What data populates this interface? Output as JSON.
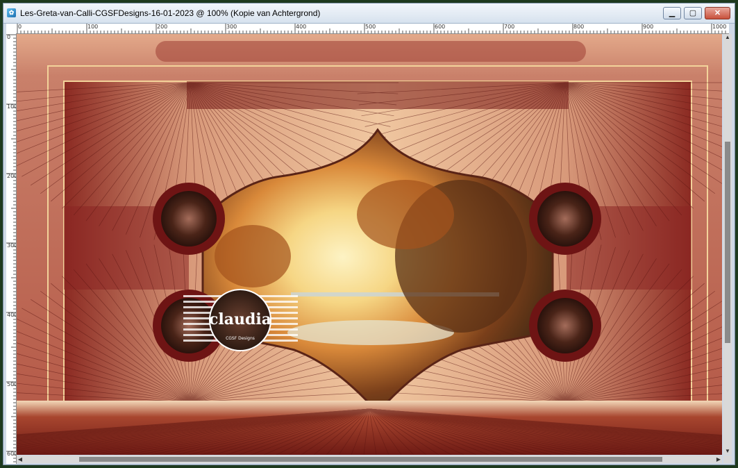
{
  "window": {
    "title": "Les-Greta-van-Calli-CGSFDesigns-16-01-2023 @ 100% (Kopie van Achtergrond)",
    "app_icon_glyph": "✿",
    "minimize_glyph": "▁",
    "maximize_glyph": "▢",
    "close_glyph": "✕"
  },
  "ruler": {
    "h_labels": [
      "0",
      "100",
      "200",
      "300",
      "400",
      "500",
      "600",
      "700",
      "800",
      "900",
      "1000"
    ],
    "v_labels": [
      "0",
      "100",
      "200",
      "300",
      "400",
      "500",
      "600"
    ]
  },
  "image": {
    "watermark_text": "claudia",
    "watermark_subtext": "CGSF Designs"
  },
  "scrollbar": {
    "up": "▲",
    "down": "▼",
    "left": "◀",
    "right": "▶"
  },
  "colors": {
    "frame_dark": "#6e1414",
    "frame_mid": "#b4533f",
    "frame_light": "#e9b58a",
    "gold": "#f3d39a",
    "sky": "#fbe7a9"
  }
}
